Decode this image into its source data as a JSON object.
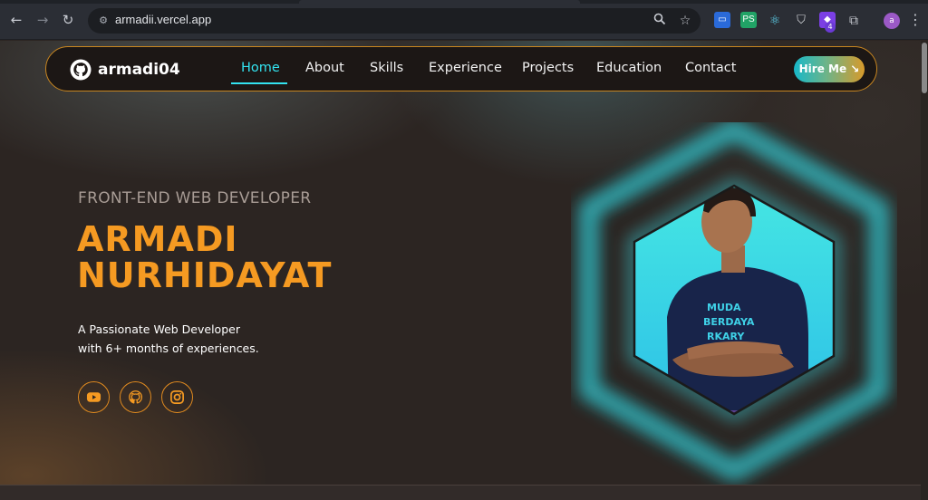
{
  "browser": {
    "url": "armadii.vercel.app",
    "profile_initial": "a",
    "extension_badge": "4",
    "icons": [
      "back-icon",
      "forward-icon",
      "reload-icon",
      "site-settings-icon",
      "zoom-icon",
      "bookmark-star-icon",
      "extension-icons",
      "extensions-puzzle-icon",
      "profile-avatar",
      "menu-icon"
    ]
  },
  "navbar": {
    "brand": "armadi04",
    "links": [
      "Home",
      "About",
      "Skills",
      "Experience",
      "Projects",
      "Education",
      "Contact"
    ],
    "active": "Home",
    "hire_label": "Hire Me ↘"
  },
  "hero": {
    "role": "FRONT-END WEB DEVELOPER",
    "name_line1": "ARMADI",
    "name_line2": "NURHIDAYAT",
    "tagline_line1": "A Passionate Web Developer",
    "tagline_line2": "with 6+ months of experiences.",
    "socials": [
      "youtube-icon",
      "github-icon",
      "instagram-icon"
    ],
    "shirt_text": [
      "MUDA",
      "BERDAYA",
      "RKARY"
    ]
  },
  "colors": {
    "accent_orange": "#f59a22",
    "accent_cyan": "#33e3f0",
    "background": "#2c2522"
  }
}
